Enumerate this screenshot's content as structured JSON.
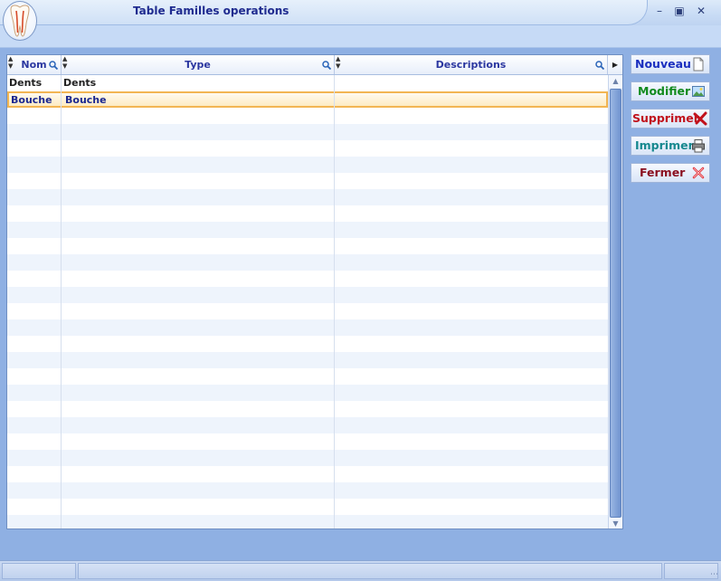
{
  "window": {
    "title": "Table Familles operations",
    "controls": [
      "minimize-icon",
      "restore-icon",
      "close-icon"
    ]
  },
  "grid": {
    "columns": [
      {
        "label": "Nom"
      },
      {
        "label": "Type"
      },
      {
        "label": "Descriptions"
      }
    ],
    "rows": [
      {
        "nom": "Dents",
        "type": "Dents",
        "description": ""
      },
      {
        "nom": "Bouche",
        "type": "Bouche",
        "description": ""
      }
    ],
    "selected_row": 1
  },
  "actions": {
    "new_label": "Nouveau",
    "edit_label": "Modifier",
    "delete_label": "Supprimer",
    "print_label": "Imprimer",
    "close_label": "Fermer"
  },
  "colors": {
    "new": "#1b2fbf",
    "edit": "#118a1e",
    "delete": "#c1121c",
    "print": "#16888f",
    "close": "#8a1020"
  }
}
